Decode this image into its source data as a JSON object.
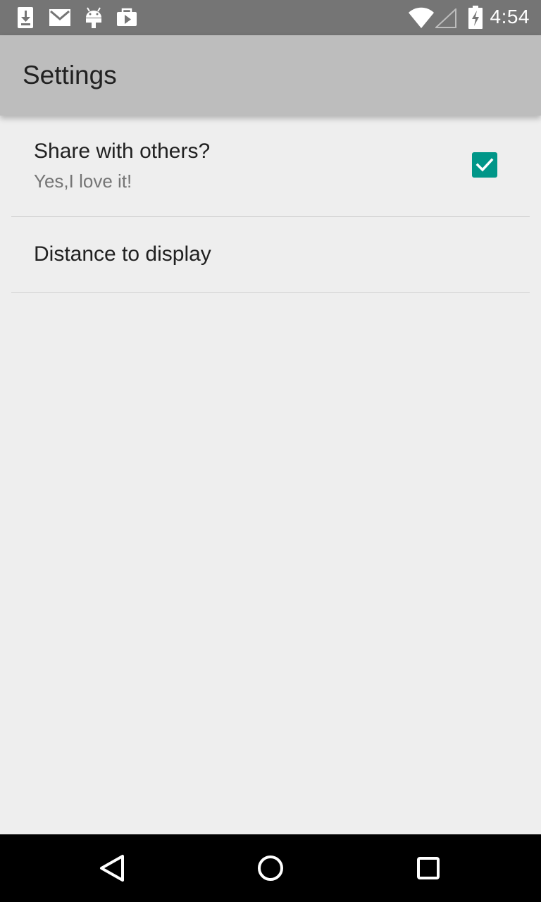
{
  "status_bar": {
    "time": "4:54",
    "left_icons": [
      "download-icon",
      "gmail-icon",
      "android-icon",
      "play-store-icon"
    ],
    "right_icons": [
      "wifi-icon",
      "signal-icon",
      "battery-charging-icon"
    ]
  },
  "app_bar": {
    "title": "Settings",
    "background_color": "#bdbdbd"
  },
  "preferences": [
    {
      "title": "Share with others?",
      "summary": "Yes,I love it!",
      "type": "checkbox",
      "checked": true
    },
    {
      "title": "Distance to display",
      "type": "dialog"
    }
  ],
  "colors": {
    "accent": "#009688",
    "background": "#eeeeee",
    "status_bar": "#757575"
  },
  "nav_bar": {
    "buttons": [
      "back-icon",
      "home-icon",
      "recents-icon"
    ]
  }
}
